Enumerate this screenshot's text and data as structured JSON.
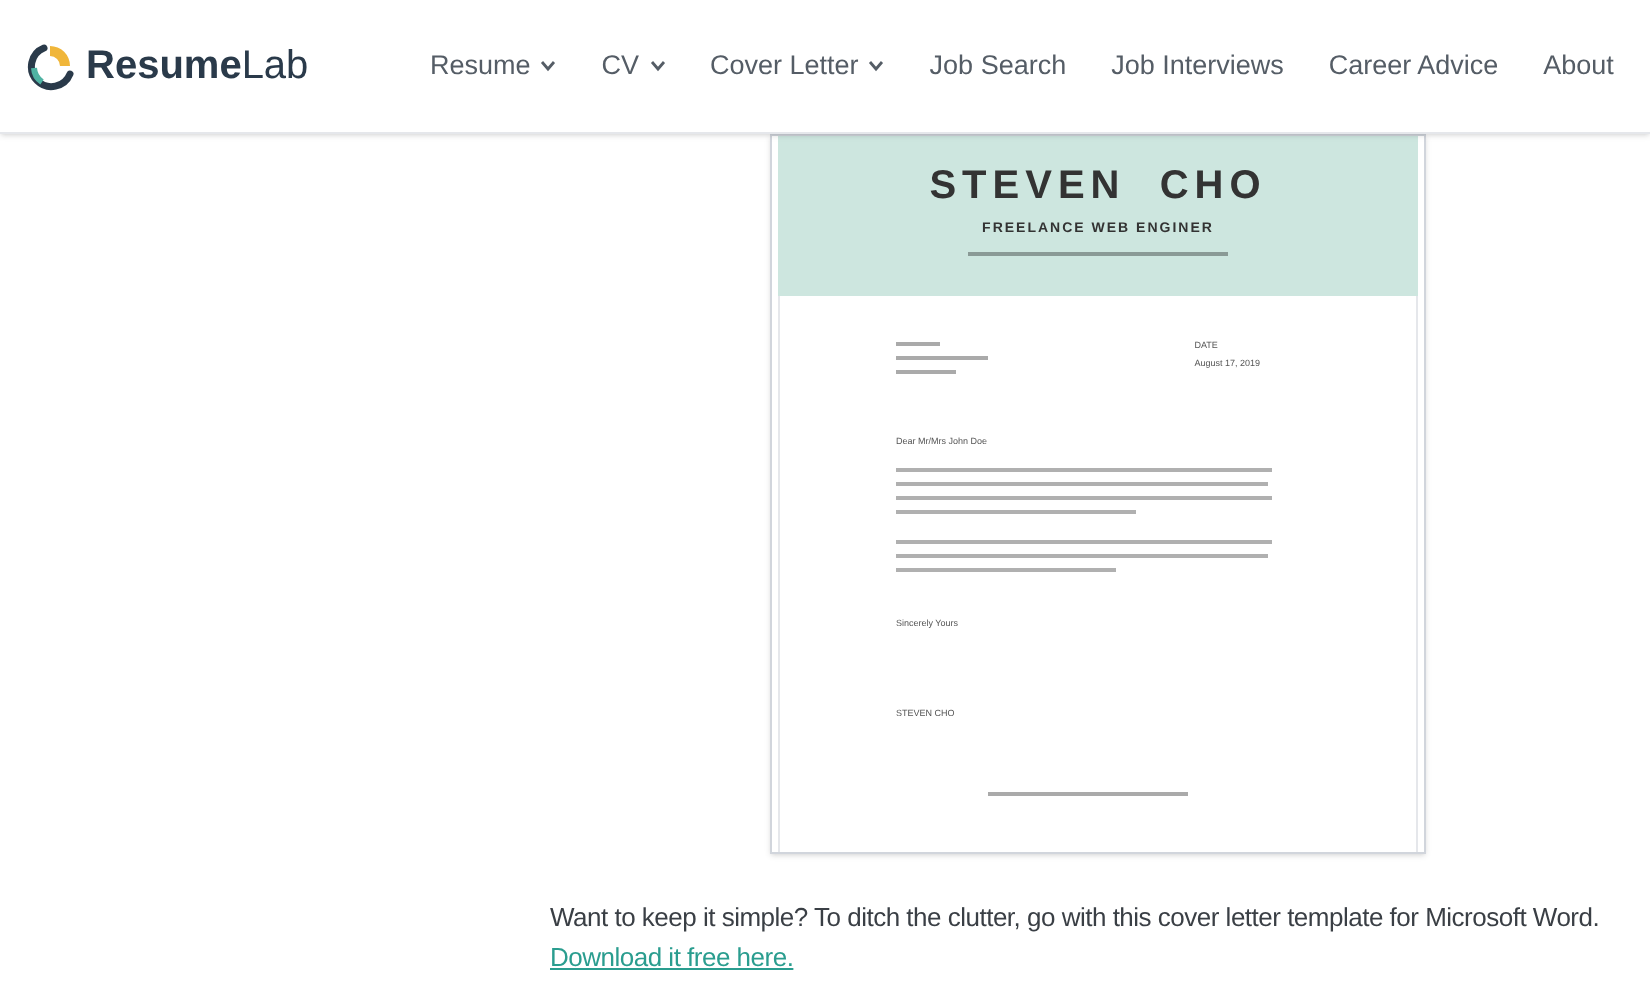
{
  "logo": {
    "text_bold": "Resume",
    "text_light": "Lab"
  },
  "nav": [
    {
      "label": "Resume",
      "dropdown": true
    },
    {
      "label": "CV",
      "dropdown": true
    },
    {
      "label": "Cover Letter",
      "dropdown": true
    },
    {
      "label": "Job Search",
      "dropdown": false
    },
    {
      "label": "Job Interviews",
      "dropdown": false
    },
    {
      "label": "Career Advice",
      "dropdown": false
    },
    {
      "label": "About",
      "dropdown": false
    }
  ],
  "letter": {
    "name": "STEVEN  CHO",
    "title": "FREELANCE WEB ENGINER",
    "date_label": "DATE",
    "date": "August 17, 2019",
    "greeting": "Dear Mr/Mrs John Doe",
    "closing": "Sincerely Yours",
    "signature": "STEVEN CHO"
  },
  "caption": "Want to keep it simple? To ditch the clutter, go with this cover letter template for Microsoft Word.",
  "link": "Download it free here."
}
